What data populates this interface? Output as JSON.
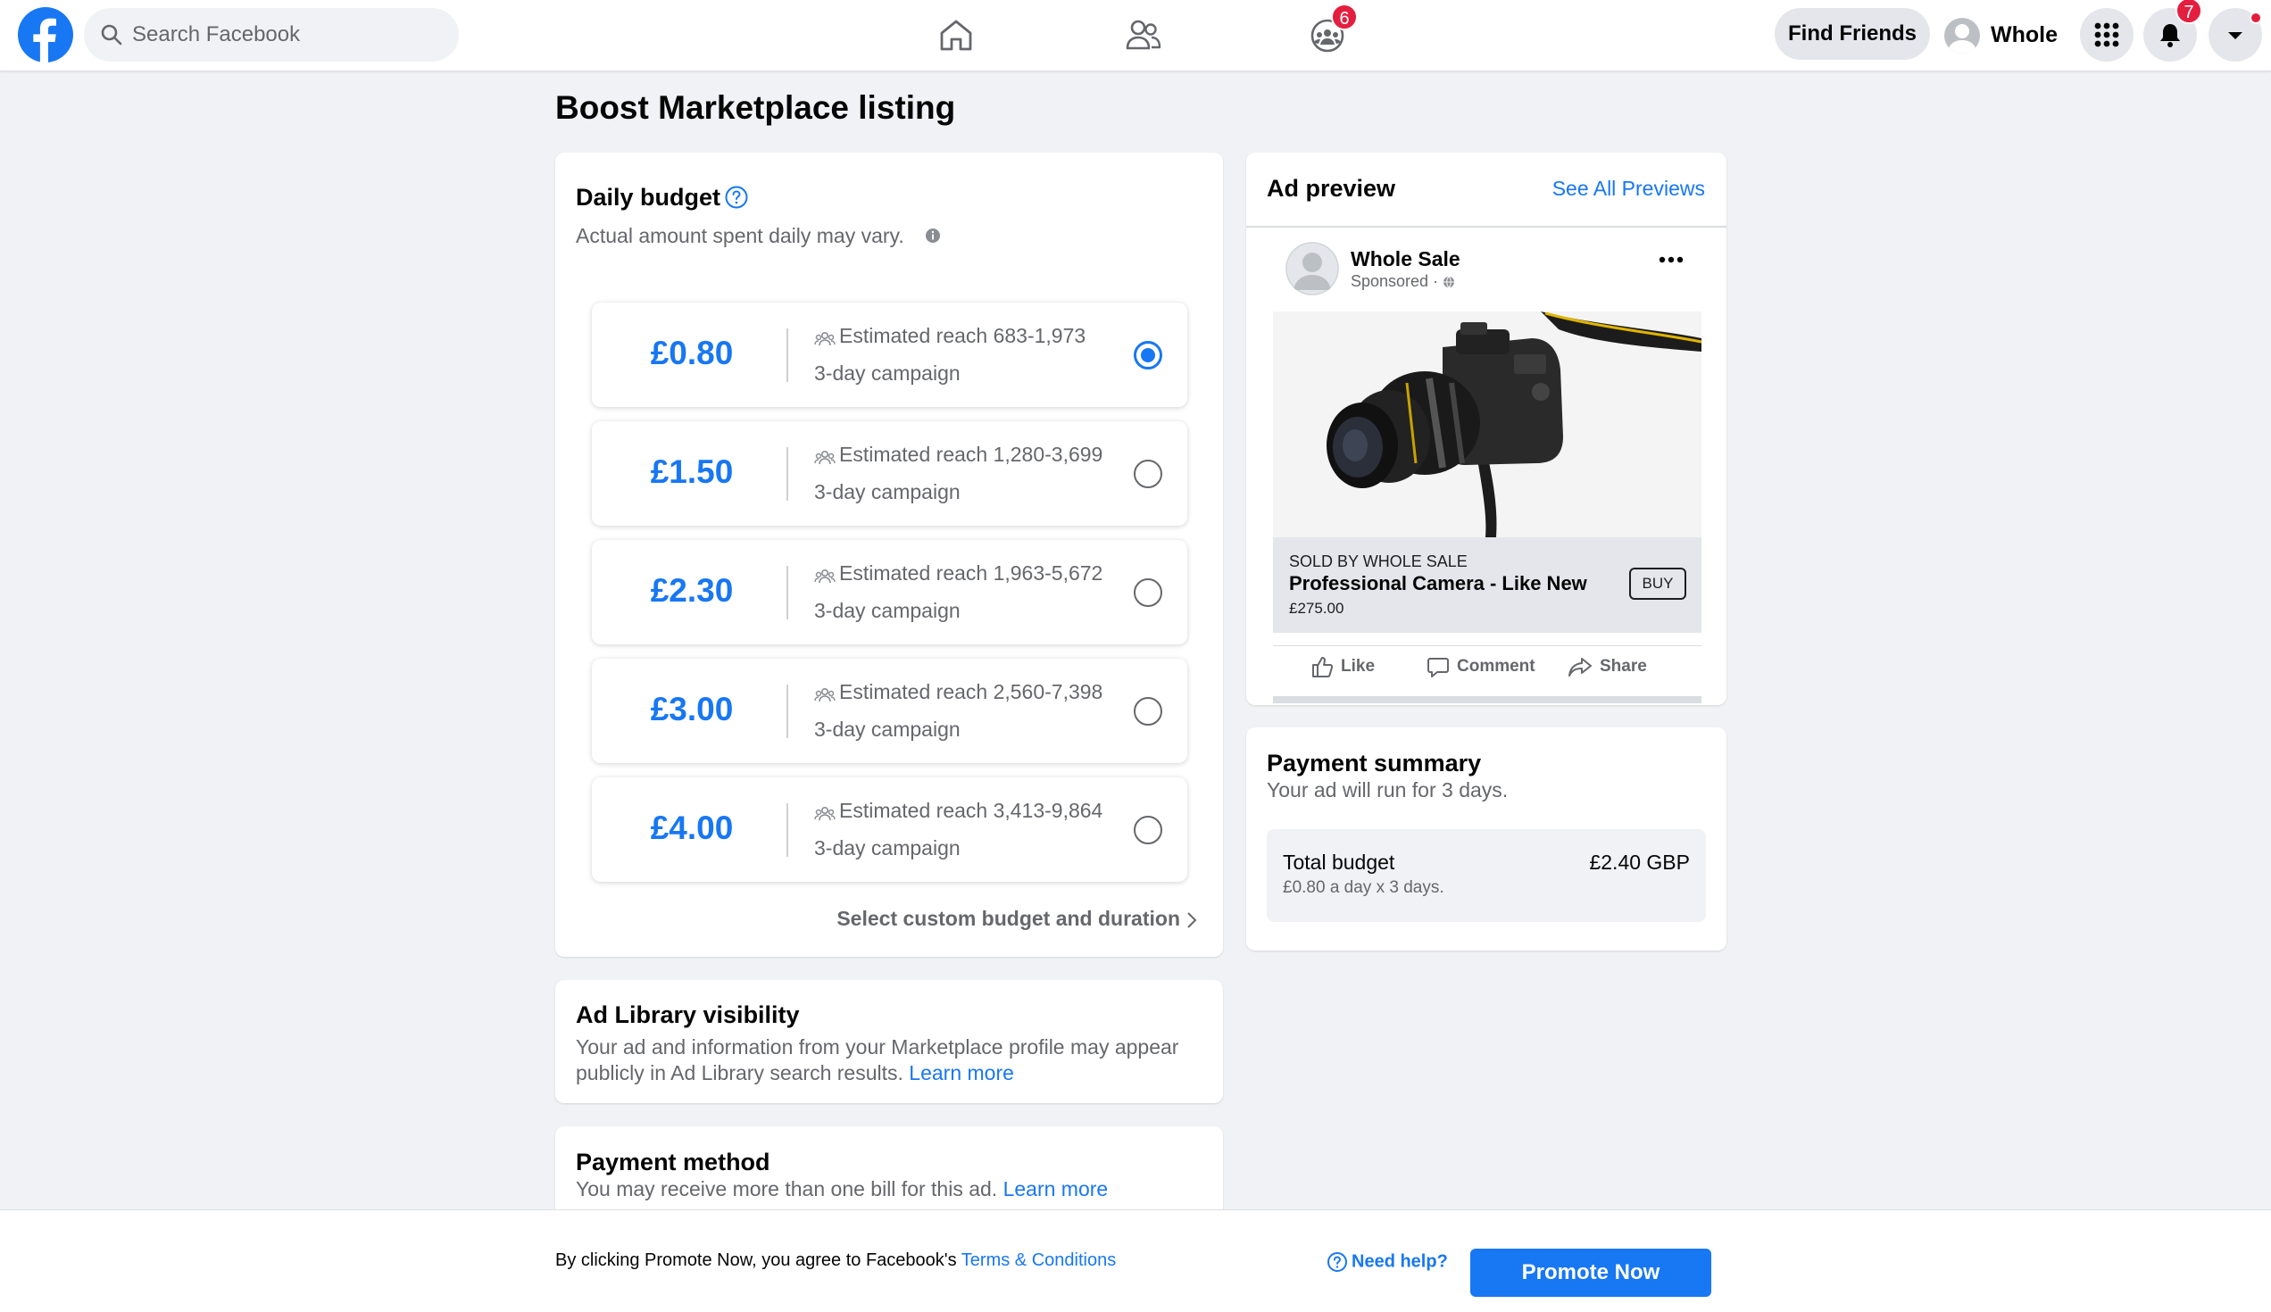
{
  "search": {
    "placeholder": "Search Facebook"
  },
  "nav": {
    "groups_badge": "6",
    "notifications_badge": "7",
    "find_friends_label": "Find Friends",
    "profile_name": "Whole"
  },
  "page": {
    "title": "Boost Marketplace listing"
  },
  "budget": {
    "title": "Daily budget",
    "subtitle": "Actual amount spent daily may vary.",
    "options": [
      {
        "price": "£0.80",
        "reach": "Estimated reach 683-1,973",
        "duration": "3-day campaign",
        "selected": true
      },
      {
        "price": "£1.50",
        "reach": "Estimated reach 1,280-3,699",
        "duration": "3-day campaign",
        "selected": false
      },
      {
        "price": "£2.30",
        "reach": "Estimated reach 1,963-5,672",
        "duration": "3-day campaign",
        "selected": false
      },
      {
        "price": "£3.00",
        "reach": "Estimated reach 2,560-7,398",
        "duration": "3-day campaign",
        "selected": false
      },
      {
        "price": "£4.00",
        "reach": "Estimated reach 3,413-9,864",
        "duration": "3-day campaign",
        "selected": false
      }
    ],
    "custom_link": "Select custom budget and duration"
  },
  "ad_library": {
    "title": "Ad Library visibility",
    "text": "Your ad and information from your Marketplace profile may appear publicly in Ad Library search results.",
    "link": "Learn more"
  },
  "payment_method": {
    "title": "Payment method",
    "text": "You may receive more than one bill for this ad.",
    "link": "Learn more"
  },
  "preview": {
    "title": "Ad preview",
    "see_all": "See All Previews",
    "page_name": "Whole Sale",
    "sponsored": "Sponsored ·",
    "sold_by": "SOLD BY WHOLE SALE",
    "product_title": "Professional Camera - Like New",
    "product_price": "£275.00",
    "buy_label": "BUY",
    "actions": {
      "like": "Like",
      "comment": "Comment",
      "share": "Share"
    }
  },
  "summary": {
    "title": "Payment summary",
    "subtitle": "Your ad will run for 3 days.",
    "total_label": "Total budget",
    "total_value": "£2.40 GBP",
    "total_detail": "£0.80 a day x 3 days."
  },
  "footer": {
    "terms_prefix": "By clicking Promote Now, you agree to Facebook's",
    "terms_link": "Terms & Conditions",
    "need_help": "Need help?",
    "promote_label": "Promote Now"
  },
  "colors": {
    "brand": "#1877f2",
    "badge": "#e41e3f",
    "background": "#f0f2f5"
  }
}
